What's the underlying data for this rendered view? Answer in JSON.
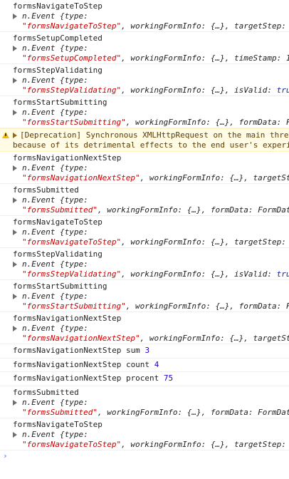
{
  "messages": [
    {
      "type": "event",
      "title": "formsNavigateToStep",
      "l1_prefix": "n.Event {type: ",
      "l2_str": "\"formsNavigateToStep\"",
      "l2_rest": ", workingFormInfo: {…}, targetStep: "
    },
    {
      "type": "event",
      "title": "formsSetupCompleted",
      "l1_prefix": "n.Event {type: ",
      "l2_str": "\"formsSetupCompleted\"",
      "l2_rest": ", workingFormInfo: {…}, timeStamp: 1"
    },
    {
      "type": "event",
      "title": "formsStepValidating",
      "l1_prefix": "n.Event {type: ",
      "l2_str": "\"formsStepValidating\"",
      "l2_rest": ", workingFormInfo: {…}, isValid: ",
      "l2_tail": "tru"
    },
    {
      "type": "event",
      "title": "formsStartSubmitting",
      "l1_prefix": "n.Event {type: ",
      "l2_str": "\"formsStartSubmitting\"",
      "l2_rest": ", workingFormInfo: {…}, formData: F"
    },
    {
      "type": "warning",
      "line1": "[Deprecation] Synchronous XMLHttpRequest on the main threa",
      "line2": "because of its detrimental effects to the end user's experi"
    },
    {
      "type": "event",
      "title": "formsNavigationNextStep",
      "l1_prefix": "n.Event {type: ",
      "l2_str": "\"formsNavigationNextStep\"",
      "l2_rest": ", workingFormInfo: {…}, targetSt"
    },
    {
      "type": "event",
      "title": "formsSubmitted",
      "l1_prefix": "n.Event {type: ",
      "l2_str": "\"formsSubmitted\"",
      "l2_rest": ", workingFormInfo: {…}, formData: FormDat"
    },
    {
      "type": "event",
      "title": "formsNavigateToStep",
      "l1_prefix": "n.Event {type: ",
      "l2_str": "\"formsNavigateToStep\"",
      "l2_rest": ", workingFormInfo: {…}, targetStep: "
    },
    {
      "type": "event",
      "title": "formsStepValidating",
      "l1_prefix": "n.Event {type: ",
      "l2_str": "\"formsStepValidating\"",
      "l2_rest": ", workingFormInfo: {…}, isValid: ",
      "l2_tail": "tru"
    },
    {
      "type": "event",
      "title": "formsStartSubmitting",
      "l1_prefix": "n.Event {type: ",
      "l2_str": "\"formsStartSubmitting\"",
      "l2_rest": ", workingFormInfo: {…}, formData: F"
    },
    {
      "type": "event",
      "title": "formsNavigationNextStep",
      "l1_prefix": "n.Event {type: ",
      "l2_str": "\"formsNavigationNextStep\"",
      "l2_rest": ", workingFormInfo: {…}, targetSt"
    },
    {
      "type": "plain",
      "text": "formsNavigationNextStep sum ",
      "value": "3"
    },
    {
      "type": "plain",
      "text": "formsNavigationNextStep count ",
      "value": "4"
    },
    {
      "type": "plain",
      "text": "formsNavigationNextStep procent ",
      "value": "75"
    },
    {
      "type": "event",
      "title": "formsSubmitted",
      "l1_prefix": "n.Event {type: ",
      "l2_str": "\"formsSubmitted\"",
      "l2_rest": ", workingFormInfo: {…}, formData: FormDat"
    },
    {
      "type": "event",
      "title": "formsNavigateToStep",
      "l1_prefix": "n.Event {type: ",
      "l2_str": "\"formsNavigateToStep\"",
      "l2_rest": ", workingFormInfo: {…}, targetStep: "
    }
  ],
  "prompt": "›",
  "colors": {
    "string": "#c80000",
    "number": "#1c00cf",
    "warning_bg": "#fffbe5",
    "warning_text": "#5c3c00",
    "prompt": "#367cf1"
  }
}
